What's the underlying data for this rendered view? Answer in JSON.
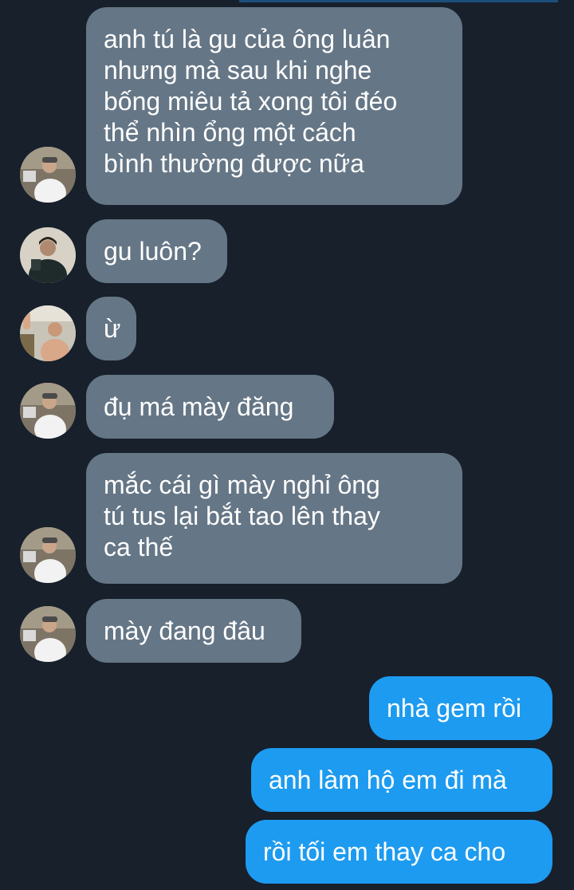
{
  "conversation": {
    "messages": [
      {
        "direction": "in",
        "avatar": "avatar-white-shirt-cap",
        "text": "anh tú là gu của ông luân\nnhưng mà sau khi nghe\nbống miêu tả xong tôi đéo\nthể nhìn ổng một cách\nbình thường được nữa"
      },
      {
        "direction": "in",
        "avatar": "avatar-dark-jacket",
        "text": "gu luôn?"
      },
      {
        "direction": "in",
        "avatar": "avatar-shirtless-waving",
        "text": "ừ"
      },
      {
        "direction": "in",
        "avatar": "avatar-white-shirt-cap",
        "text": "đụ má mày đăng"
      },
      {
        "direction": "in",
        "avatar": "avatar-white-shirt-cap",
        "text": "mắc cái gì mày nghỉ ông\ntú tus lại bắt tao lên thay\nca thế"
      },
      {
        "direction": "in",
        "avatar": "avatar-white-shirt-cap",
        "text": "mày đang đâu"
      },
      {
        "direction": "out",
        "text": "nhà gem rồi"
      },
      {
        "direction": "out",
        "text": "anh làm hộ em đi mà"
      },
      {
        "direction": "out",
        "text": "rồi tối em thay ca cho"
      }
    ]
  },
  "colors": {
    "background": "#17202b",
    "incoming_bubble": "#657686",
    "outgoing_bubble": "#1d9bf0",
    "text": "#ffffff"
  }
}
